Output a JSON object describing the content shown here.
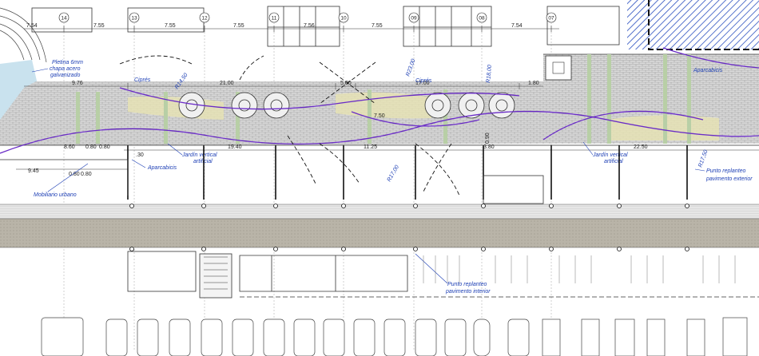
{
  "grid_markers": [
    "14",
    "13",
    "12",
    "11",
    "10",
    "09",
    "08",
    "07"
  ],
  "top_dimensions": [
    "7.54",
    "7.55",
    "7.55",
    "7.55",
    "7.56",
    "7.55",
    "7.54"
  ],
  "annotations": {
    "pletina": [
      "Pletina 6mm",
      "chapa acero",
      "galvanizado"
    ],
    "cipres_1": "Ciprés",
    "cipres_2": "Ciprés",
    "aparcabicis_1": "Aparcabicis",
    "aparcabicis_2": "Aparcabicis",
    "jardin_1": [
      "Jardín vertical",
      "artificial"
    ],
    "jardin_2": [
      "Jardín vertical",
      "artificial"
    ],
    "mobiliario": "Mobiliario urbano",
    "punto_exterior": [
      "Punto replanteo",
      "pavimento exterior"
    ],
    "punto_interior": [
      "Punto replanteo",
      "pavimento interior"
    ]
  },
  "dimensions": {
    "d_976": "9.76",
    "d_2100": "21.00",
    "d_500": "5.00",
    "d_1700": "17.00",
    "d_180": "1.80",
    "d_1940": "19.40",
    "d_1125": "11.25",
    "d_380": "3.80",
    "d_2250": "22.50",
    "d_945": "9.45",
    "d_080a": "0.80",
    "d_080b": "0.80",
    "d_030": ".30",
    "d_r1450": "R14,50",
    "d_r2300": "R23,00",
    "d_r1800": "R18,00",
    "d_r1700": "R17,00",
    "d_r1750": "R17,50",
    "d_090": "0.90",
    "d_750": "7.50",
    "d_860": "8.60",
    "d_080c": "0.80",
    "d_080d": "0.80"
  }
}
